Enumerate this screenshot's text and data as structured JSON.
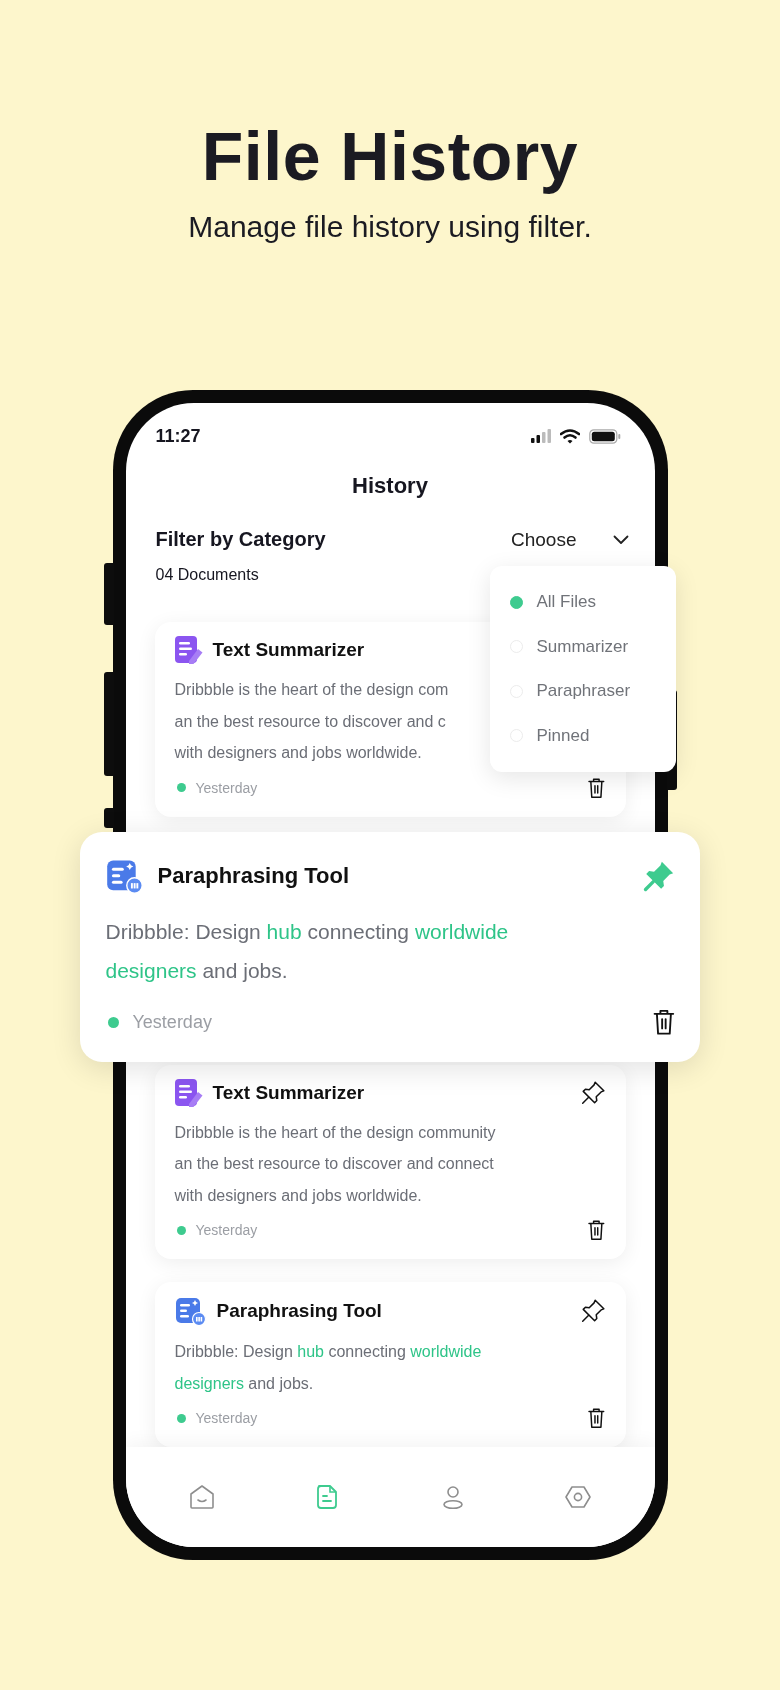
{
  "headline": {
    "title": "File History",
    "subtitle": "Manage file history using filter."
  },
  "status_bar": {
    "time": "11:27"
  },
  "screen": {
    "title": "History",
    "filter_label": "Filter by Category",
    "filter_value": "Choose",
    "count": "04 Documents"
  },
  "dropdown": {
    "options": [
      {
        "label": "All Files",
        "selected": true
      },
      {
        "label": "Summarizer",
        "selected": false
      },
      {
        "label": "Paraphraser",
        "selected": false
      },
      {
        "label": "Pinned",
        "selected": false
      }
    ]
  },
  "documents": [
    {
      "kind": "summarizer",
      "elevated": false,
      "title": "Text Summarizer",
      "lines": [
        "Dribbble is the heart of the design com",
        "an the best resource to discover and c",
        "with designers and jobs worldwide."
      ],
      "date": "Yesterday"
    },
    {
      "kind": "paraphraser",
      "elevated": true,
      "pinned": true,
      "title": "Paraphrasing Tool",
      "lines": [
        "Dribbble: Design **hub** connecting **worldwide**",
        "**designers** and jobs."
      ],
      "date": "Yesterday"
    },
    {
      "kind": "summarizer",
      "elevated": false,
      "pinned": false,
      "title": "Text Summarizer",
      "lines": [
        "Dribbble is the heart of the design community",
        "an the best resource to discover and connect",
        "with designers and jobs worldwide."
      ],
      "date": "Yesterday"
    },
    {
      "kind": "paraphraser",
      "elevated": false,
      "pinned": false,
      "title": "Paraphrasing Tool",
      "lines": [
        "Dribbble: Design **hub** connecting **worldwide**",
        "**designers** and jobs."
      ],
      "date": "Yesterday"
    }
  ],
  "nav": [
    {
      "kind": "home",
      "selected": false
    },
    {
      "kind": "documents",
      "selected": true
    },
    {
      "kind": "profile",
      "selected": false
    },
    {
      "kind": "settings",
      "selected": false
    }
  ]
}
